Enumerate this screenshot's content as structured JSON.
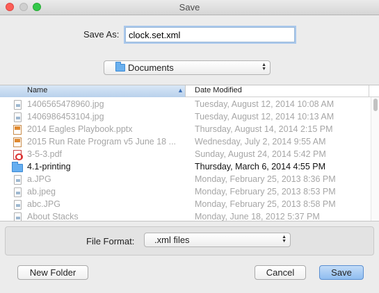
{
  "window": {
    "title": "Save"
  },
  "save_as": {
    "label": "Save As:",
    "value": "clock.set.xml"
  },
  "location": {
    "label": "Documents",
    "icon": "folder-icon"
  },
  "columns": {
    "name": "Name",
    "date": "Date Modified"
  },
  "files": [
    {
      "name": "1406565478960.jpg",
      "date": "Tuesday, August 12, 2014 10:08 AM",
      "icon": "image-file-icon",
      "enabled": false
    },
    {
      "name": "1406986453104.jpg",
      "date": "Tuesday, August 12, 2014 10:13 AM",
      "icon": "image-file-icon",
      "enabled": false
    },
    {
      "name": "2014 Eagles Playbook.pptx",
      "date": "Thursday, August 14, 2014 2:15 PM",
      "icon": "powerpoint-file-icon",
      "enabled": false
    },
    {
      "name": "2015 Run Rate Program v5 June 18 ...",
      "date": "Wednesday, July 2, 2014 9:55 AM",
      "icon": "powerpoint-file-icon",
      "enabled": false
    },
    {
      "name": "3-5-3.pdf",
      "date": "Sunday, August 24, 2014 5:42 PM",
      "icon": "pdf-file-icon",
      "enabled": false
    },
    {
      "name": "4.1-printing",
      "date": "Thursday, March 6, 2014 4:55 PM",
      "icon": "folder-icon",
      "enabled": true
    },
    {
      "name": "a.JPG",
      "date": "Monday, February 25, 2013 8:36 PM",
      "icon": "image-file-icon",
      "enabled": false
    },
    {
      "name": "ab.jpeg",
      "date": "Monday, February 25, 2013 8:53 PM",
      "icon": "image-file-icon",
      "enabled": false
    },
    {
      "name": "abc.JPG",
      "date": "Monday, February 25, 2013 8:58 PM",
      "icon": "image-file-icon",
      "enabled": false
    },
    {
      "name": "About Stacks",
      "date": "Monday, June 18, 2012 5:37 PM",
      "icon": "document-file-icon",
      "enabled": false
    }
  ],
  "file_format": {
    "label": "File Format:",
    "value": ".xml files"
  },
  "buttons": {
    "new_folder": "New Folder",
    "cancel": "Cancel",
    "save": "Save"
  },
  "colors": {
    "accent": "#5b8fd0",
    "header_selected": "#b8d1ec"
  }
}
